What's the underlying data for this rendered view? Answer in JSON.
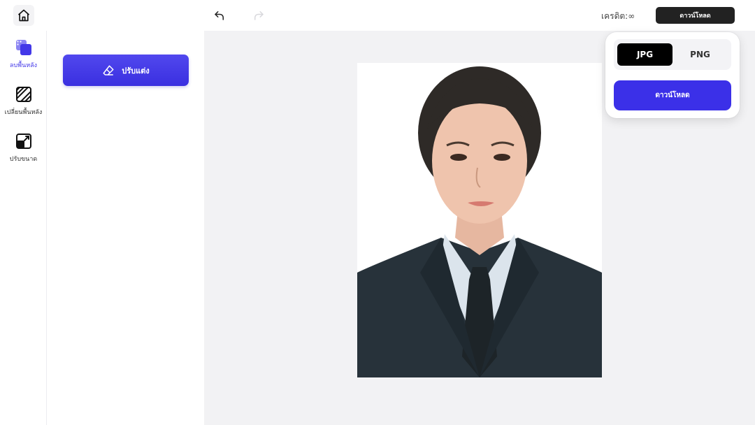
{
  "topbar": {
    "home_icon": "home-icon",
    "undo_icon": "undo-icon",
    "redo_icon": "redo-icon",
    "credit_label": "เครดิต:∞",
    "download_label": "ดาวน์โหลด"
  },
  "rail": {
    "items": [
      {
        "label": "ลบพื้นหลัง",
        "icon": "remove-background-icon",
        "active": true
      },
      {
        "label": "เปลี่ยนพื้นหลัง",
        "icon": "change-background-icon",
        "active": false
      },
      {
        "label": "ปรับขนาด",
        "icon": "resize-icon",
        "active": false
      }
    ]
  },
  "tools": {
    "retouch_label": "ปรับแต่ง",
    "retouch_icon": "eraser-icon"
  },
  "canvas": {
    "image_icon": "portrait-photo"
  },
  "export": {
    "formats": [
      "JPG",
      "PNG"
    ],
    "selected_format": "JPG",
    "download_label": "ดาวน์โหลด"
  },
  "colors": {
    "accent": "#3b30e8",
    "active_nav": "#4338e8",
    "dark_button": "#222222"
  }
}
